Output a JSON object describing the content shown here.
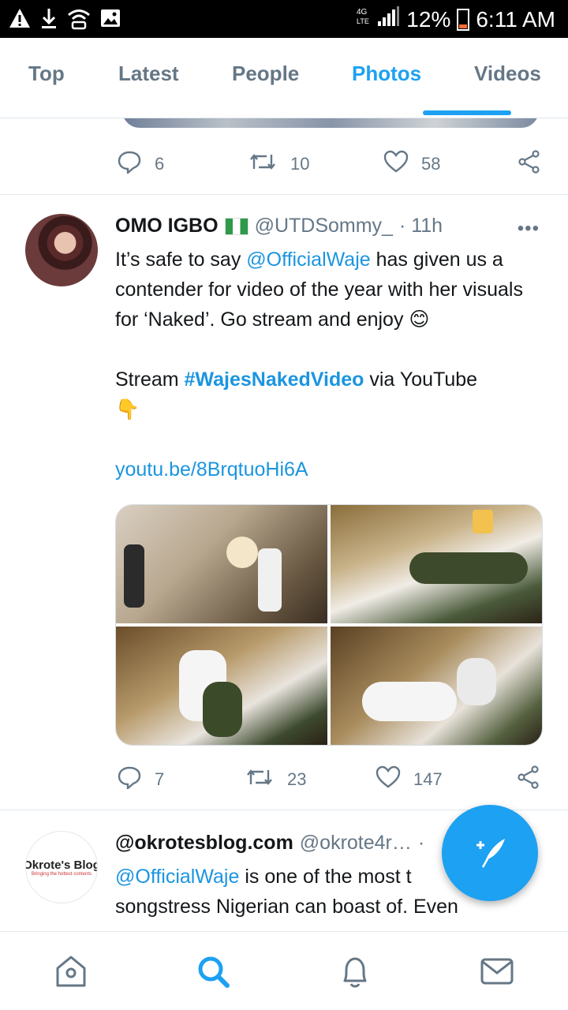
{
  "status_bar": {
    "network": "4G LTE",
    "battery": "12%",
    "time": "6:11 AM",
    "left_icons": [
      "warning-icon",
      "download-icon",
      "wifi-icon",
      "image-icon"
    ]
  },
  "tabs": [
    {
      "label": "Top",
      "active": false
    },
    {
      "label": "Latest",
      "active": false
    },
    {
      "label": "People",
      "active": false
    },
    {
      "label": "Photos",
      "active": true
    },
    {
      "label": "Videos",
      "active": false
    }
  ],
  "prev_tweet": {
    "replies": "6",
    "retweets": "10",
    "likes": "58"
  },
  "tweet1": {
    "name": "OMO IGBO",
    "flag": "Nigeria flag",
    "handle": "@UTDSommy_",
    "time": "· 11h",
    "more": "•••",
    "text_part1": "It’s safe to say ",
    "mention": "@OfficialWaje",
    "text_part2": " has given us a contender for video of the year with her visuals for ‘Naked’. Go stream and enjoy ",
    "emoji1": "😊",
    "stream_prefix": "Stream ",
    "hashtag": "#WajesNakedVideo",
    "stream_suffix": " via YouTube",
    "emoji2": "👇",
    "link": "youtu.be/8BrqtuoHi6A",
    "replies": "7",
    "retweets": "23",
    "likes": "147"
  },
  "tweet2": {
    "avatar_title": "Okrote's Blog",
    "avatar_subtitle": "Bringing the hottest contents",
    "name": "@okrotesblog.com",
    "handle": "@okrote4r…",
    "time": "·",
    "mention": "@OfficialWaje",
    "text_part1": " is one of the most t",
    "line2": "songstress Nigerian can boast of. Even"
  },
  "bottom_nav": [
    "home-icon",
    "search-icon",
    "notifications-icon",
    "messages-icon"
  ],
  "colors": {
    "accent": "#1da1f2",
    "secondary_text": "#657786",
    "divider": "#e1e8ed"
  }
}
